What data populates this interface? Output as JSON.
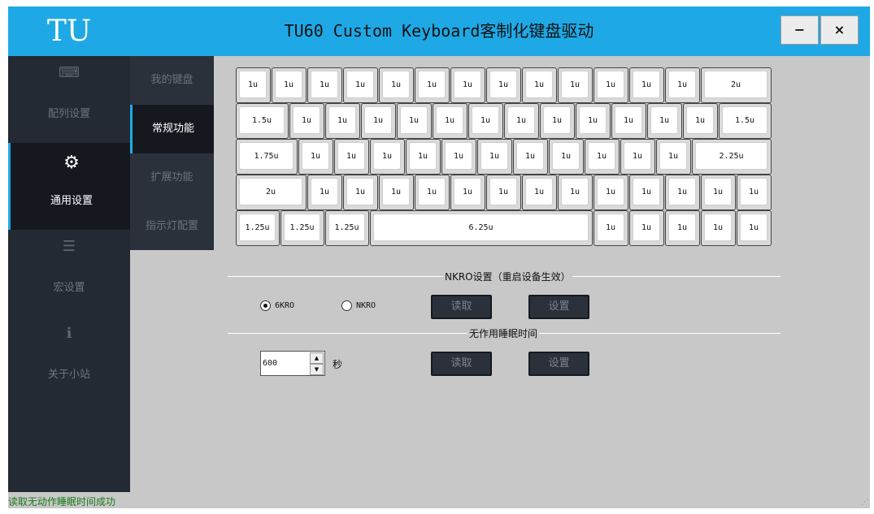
{
  "window": {
    "logo": "TU",
    "title": "TU60 Custom Keyboard客制化键盘驱动",
    "minimize_label": "−",
    "close_label": "×"
  },
  "sidebar": {
    "items": [
      {
        "icon": "⌨",
        "label": "配列设置",
        "icon_name": "keyboard-icon",
        "active": false
      },
      {
        "icon": "⚙",
        "label": "通用设置",
        "icon_name": "gears-icon",
        "active": true
      },
      {
        "icon": "☰",
        "label": "宏设置",
        "icon_name": "list-icon",
        "active": false
      },
      {
        "icon": "i",
        "label": "关于小站",
        "icon_name": "info-icon",
        "active": false
      }
    ]
  },
  "subnav": {
    "items": [
      {
        "label": "我的键盘",
        "active": false
      },
      {
        "label": "常规功能",
        "active": true
      },
      {
        "label": "扩展功能",
        "active": false
      },
      {
        "label": "指示灯配置",
        "active": false
      }
    ]
  },
  "keyboard": {
    "rows": [
      [
        "1u",
        "1u",
        "1u",
        "1u",
        "1u",
        "1u",
        "1u",
        "1u",
        "1u",
        "1u",
        "1u",
        "1u",
        "1u",
        "2u"
      ],
      [
        "1.5u",
        "1u",
        "1u",
        "1u",
        "1u",
        "1u",
        "1u",
        "1u",
        "1u",
        "1u",
        "1u",
        "1u",
        "1u",
        "1.5u"
      ],
      [
        "1.75u",
        "1u",
        "1u",
        "1u",
        "1u",
        "1u",
        "1u",
        "1u",
        "1u",
        "1u",
        "1u",
        "1u",
        "2.25u"
      ],
      [
        "2u",
        "1u",
        "1u",
        "1u",
        "1u",
        "1u",
        "1u",
        "1u",
        "1u",
        "1u",
        "1u",
        "1u",
        "1u",
        "1u"
      ],
      [
        "1.25u",
        "1.25u",
        "1.25u",
        "6.25u",
        "1u",
        "1u",
        "1u",
        "1u",
        "1u"
      ]
    ]
  },
  "nkro": {
    "title": "NKRO设置（重启设备生效）",
    "options": [
      {
        "label": "6KRO",
        "checked": true
      },
      {
        "label": "NKRO",
        "checked": false
      }
    ],
    "read_label": "读取",
    "set_label": "设置"
  },
  "sleep": {
    "title": "无作用睡眠时间",
    "value": "600",
    "unit": "秒",
    "up": "▲",
    "down": "▼",
    "read_label": "读取",
    "set_label": "设置"
  },
  "status": {
    "text": "读取无动作睡眠时间成功",
    "color": "#1a7a1a"
  },
  "colors": {
    "accent": "#1ea9e6",
    "sidebar": "#242a33",
    "background": "#c8c8c8"
  }
}
